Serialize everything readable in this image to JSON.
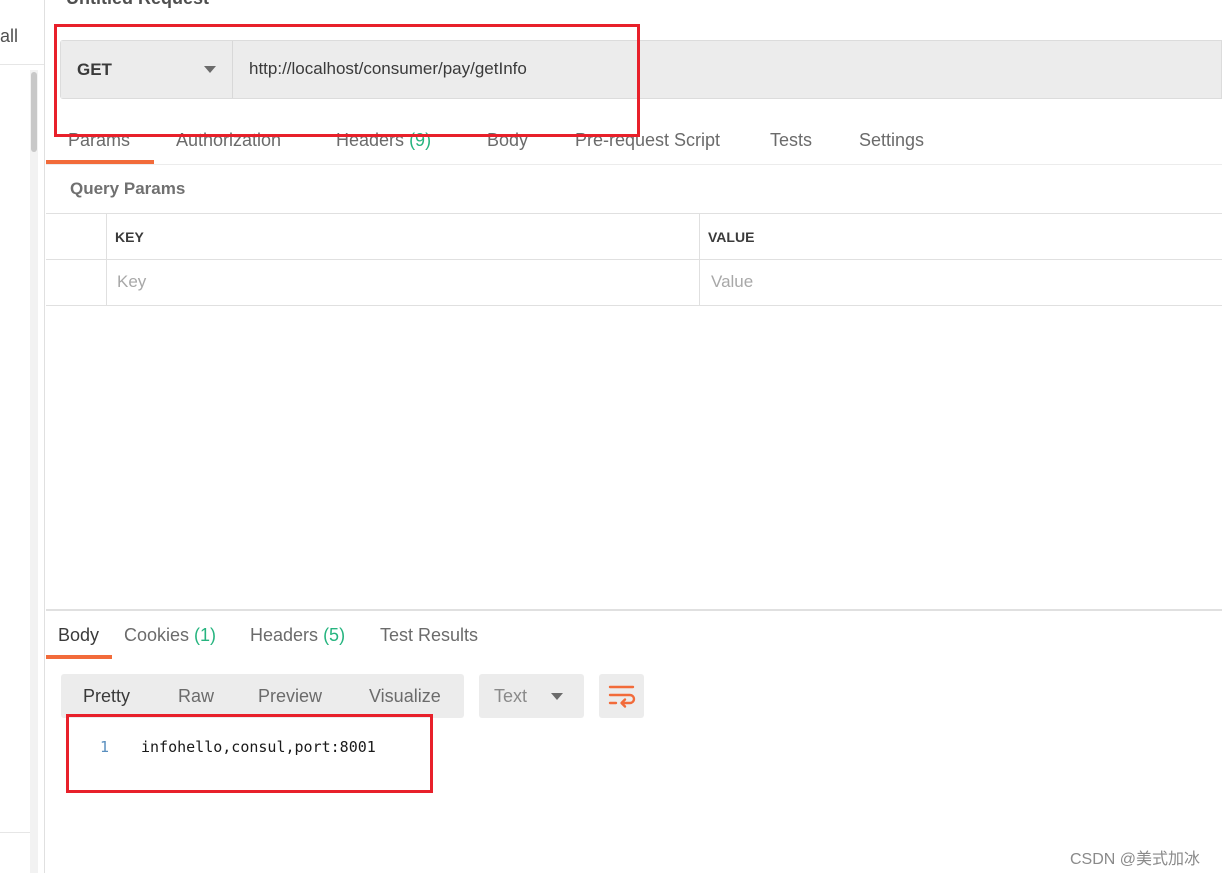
{
  "sidebar": {
    "partial_text": "all"
  },
  "request": {
    "title": "Untitled Request",
    "method": "GET",
    "url": "http://localhost/consumer/pay/getInfo"
  },
  "request_tabs": [
    {
      "label": "Params"
    },
    {
      "label": "Authorization"
    },
    {
      "label": "Headers",
      "count": "(9)"
    },
    {
      "label": "Body"
    },
    {
      "label": "Pre-request Script"
    },
    {
      "label": "Tests"
    },
    {
      "label": "Settings"
    }
  ],
  "query_params": {
    "title": "Query Params",
    "columns": [
      "KEY",
      "VALUE"
    ],
    "placeholders": {
      "key": "Key",
      "value": "Value"
    }
  },
  "response_tabs": [
    {
      "label": "Body"
    },
    {
      "label": "Cookies",
      "count": "(1)"
    },
    {
      "label": "Headers",
      "count": "(5)"
    },
    {
      "label": "Test Results"
    }
  ],
  "response_view": {
    "modes": [
      "Pretty",
      "Raw",
      "Preview",
      "Visualize"
    ],
    "format": "Text",
    "lines": [
      {
        "number": "1",
        "text": "infohello,consul,port:8001"
      }
    ]
  },
  "colors": {
    "accent": "#f26b3a",
    "count_green": "#26b47f",
    "annotation_red": "#e8202a"
  },
  "watermark": "CSDN @美式加冰"
}
